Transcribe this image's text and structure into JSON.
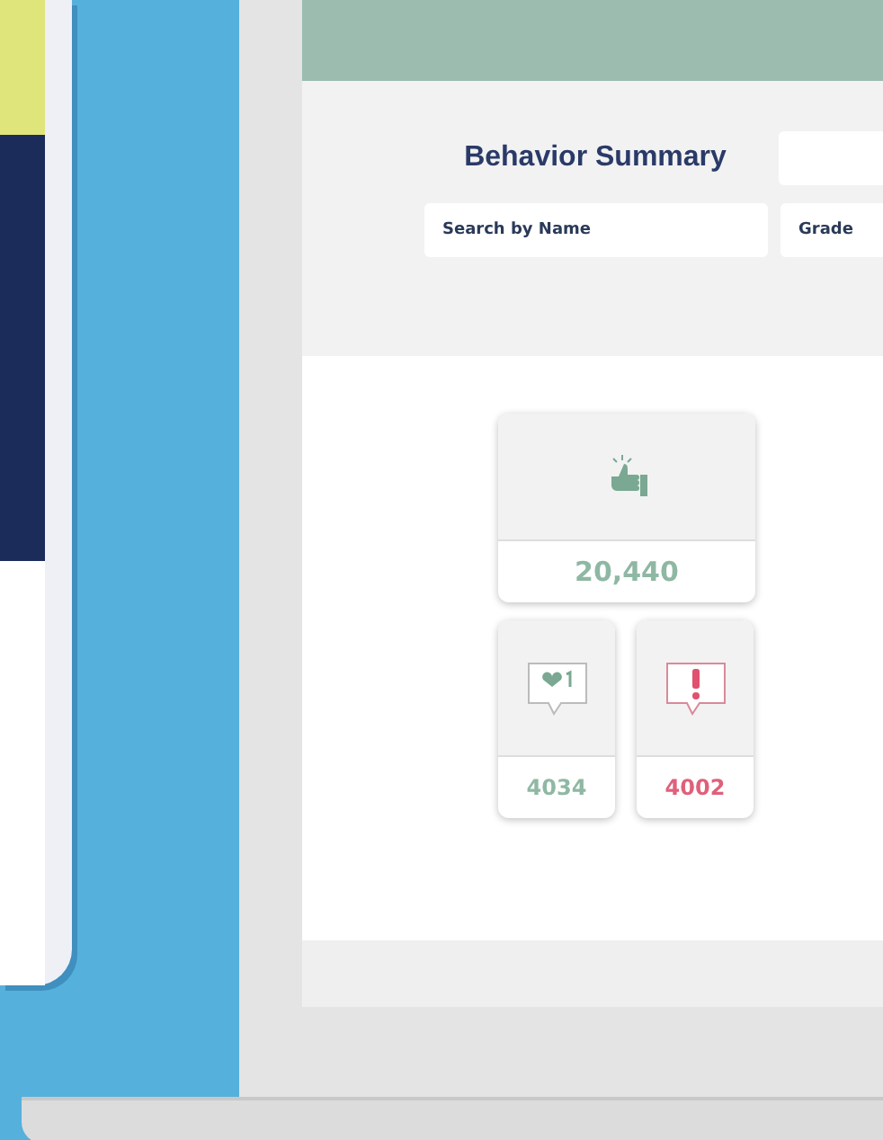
{
  "header": {
    "title": "Behavior Summary"
  },
  "filters": {
    "search": {
      "placeholder": "Search by Name"
    },
    "grade": {
      "placeholder": "Grade"
    }
  },
  "total": {
    "value": "20,440",
    "color": "#8fb8a4"
  },
  "stats": [
    {
      "kind": "positive",
      "value": "4034",
      "color": "#8fb8a4"
    },
    {
      "kind": "negative",
      "value": "4002",
      "color": "#e0607a"
    }
  ]
}
